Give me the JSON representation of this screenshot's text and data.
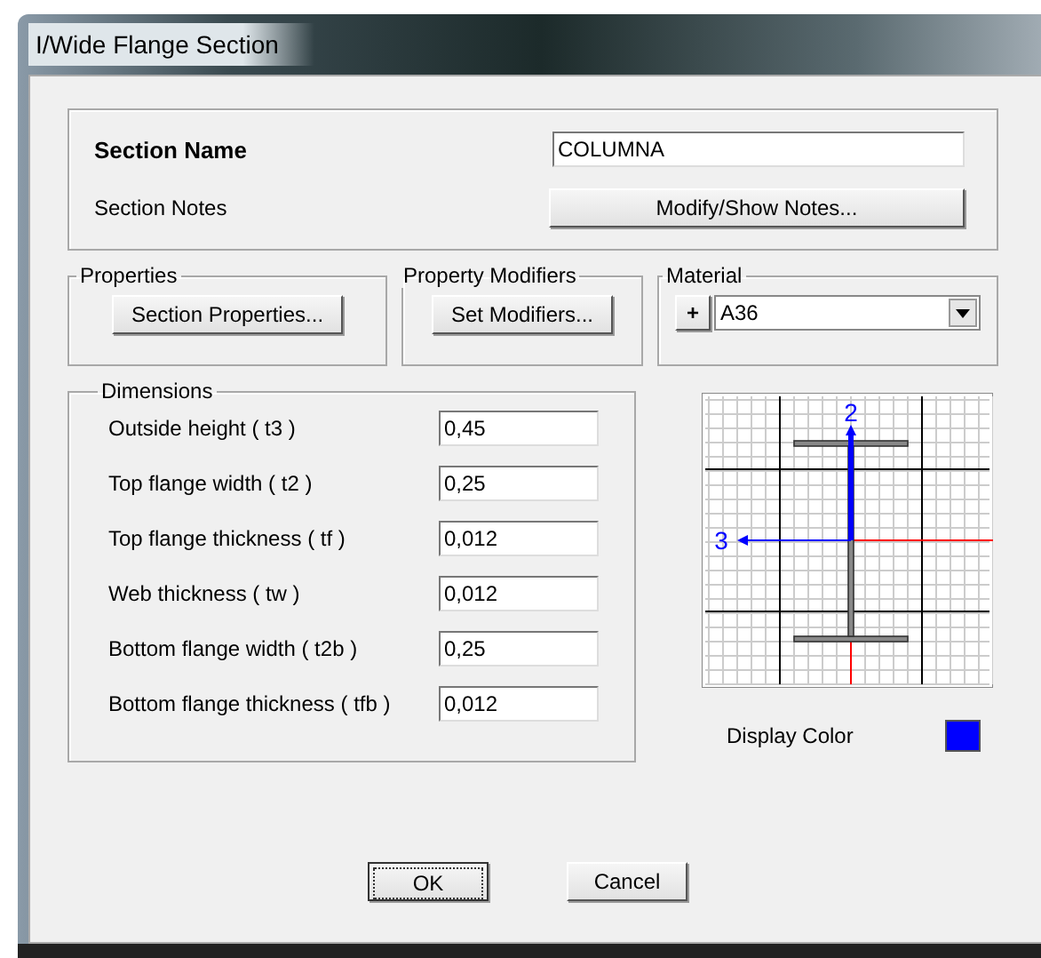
{
  "window": {
    "title": "I/Wide Flange Section"
  },
  "section_name": {
    "label": "Section Name",
    "value": "COLUMNA"
  },
  "section_notes": {
    "label": "Section Notes",
    "button": "Modify/Show Notes..."
  },
  "properties": {
    "title": "Properties",
    "button": "Section Properties..."
  },
  "property_modifiers": {
    "title": "Property Modifiers",
    "button": "Set Modifiers..."
  },
  "material": {
    "title": "Material",
    "add_button": "+",
    "value": "A36"
  },
  "dimensions": {
    "title": "Dimensions",
    "rows": [
      {
        "label": "Outside height  ( t3 )",
        "value": "0,45"
      },
      {
        "label": "Top flange width  ( t2 )",
        "value": "0,25"
      },
      {
        "label": "Top flange thickness  ( tf )",
        "value": "0,012"
      },
      {
        "label": "Web thickness  ( tw )",
        "value": "0,012"
      },
      {
        "label": "Bottom flange width  ( t2b )",
        "value": "0,25"
      },
      {
        "label": "Bottom flange thickness  ( tfb )",
        "value": "0,012"
      }
    ]
  },
  "diagram": {
    "axis_2": "2",
    "axis_3": "3"
  },
  "display_color": {
    "label": "Display Color",
    "color": "#0000ff"
  },
  "buttons": [
    {
      "label": "OK",
      "focused": true
    },
    {
      "label": "Cancel",
      "focused": false
    }
  ]
}
